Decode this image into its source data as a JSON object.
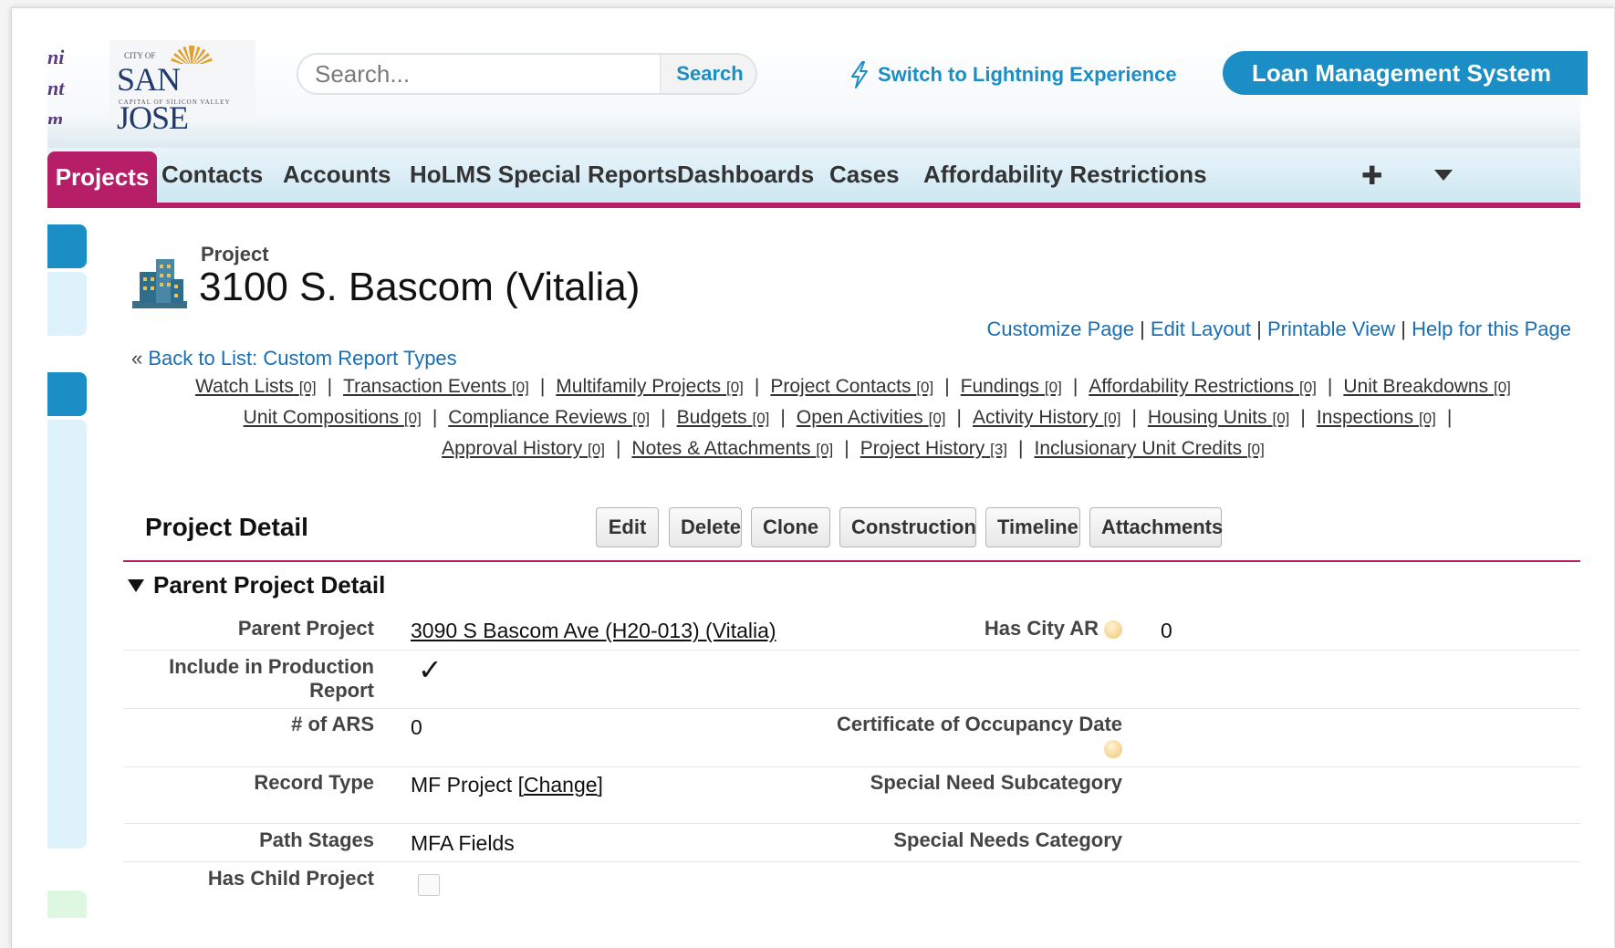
{
  "header": {
    "sliver_text": [
      "ni",
      "nt",
      "m"
    ],
    "logo": {
      "small": "CITY OF",
      "main": "SAN JOSE",
      "sub": "CAPITAL OF SILICON VALLEY"
    },
    "search": {
      "placeholder": "Search...",
      "button": "Search"
    },
    "lightning_link": "Switch to Lightning Experience",
    "app_button": "Loan Management System"
  },
  "tabs": [
    "Projects",
    "Contacts",
    "Accounts",
    "HoLMS Special Reports",
    "Dashboards",
    "Cases",
    "Affordability Restrictions"
  ],
  "page": {
    "label": "Project",
    "title": "3100 S. Bascom (Vitalia)",
    "top_links": [
      "Customize Page",
      "Edit Layout",
      "Printable View",
      "Help for this Page"
    ],
    "back_prefix": "«",
    "back_link": "Back to List: Custom Report Types"
  },
  "related_lists": [
    [
      {
        "name": "Watch Lists",
        "count": "[0]"
      },
      {
        "name": "Transaction Events",
        "count": "[0]"
      },
      {
        "name": "Multifamily Projects",
        "count": "[0]"
      },
      {
        "name": "Project Contacts",
        "count": "[0]"
      },
      {
        "name": "Fundings",
        "count": "[0]"
      },
      {
        "name": "Affordability Restrictions",
        "count": "[0]"
      },
      {
        "name": "Unit Breakdowns",
        "count": "[0]"
      }
    ],
    [
      {
        "name": "Unit Compositions",
        "count": "[0]"
      },
      {
        "name": "Compliance Reviews",
        "count": "[0]"
      },
      {
        "name": "Budgets",
        "count": "[0]"
      },
      {
        "name": "Open Activities",
        "count": "[0]"
      },
      {
        "name": "Activity History",
        "count": "[0]"
      },
      {
        "name": "Housing Units",
        "count": "[0]"
      },
      {
        "name": "Inspections",
        "count": "[0]"
      }
    ],
    [
      {
        "name": "Approval History",
        "count": "[0]"
      },
      {
        "name": "Notes & Attachments",
        "count": "[0]"
      },
      {
        "name": "Project History",
        "count": "[3]"
      },
      {
        "name": "Inclusionary Unit Credits",
        "count": "[0]"
      }
    ]
  ],
  "detail": {
    "title": "Project Detail",
    "buttons": [
      "Edit",
      "Delete",
      "Clone",
      "Construction",
      "Timeline",
      "Attachments"
    ],
    "section_title": "Parent Project Detail",
    "fields": {
      "parent_project": {
        "label": "Parent Project",
        "value": "3090 S Bascom Ave (H20-013) (Vitalia)"
      },
      "include_in_production": {
        "label": "Include in Production Report",
        "checked": true
      },
      "num_ars": {
        "label": "# of ARS",
        "value": "0"
      },
      "record_type": {
        "label": "Record Type",
        "value": "MF Project",
        "change": "Change"
      },
      "path_stages": {
        "label": "Path Stages",
        "value": "MFA Fields"
      },
      "has_child_project": {
        "label": "Has Child Project",
        "checked": false
      },
      "has_city_ar": {
        "label": "Has City AR",
        "value": "0"
      },
      "cert_occupancy": {
        "label": "Certificate of Occupancy Date",
        "value": ""
      },
      "special_need_sub": {
        "label": "Special Need Subcategory",
        "value": ""
      },
      "special_needs_cat": {
        "label": "Special Needs Category",
        "value": ""
      }
    }
  },
  "colors": {
    "brand_blue": "#1a8ec5",
    "tab_active": "#b61f68"
  }
}
